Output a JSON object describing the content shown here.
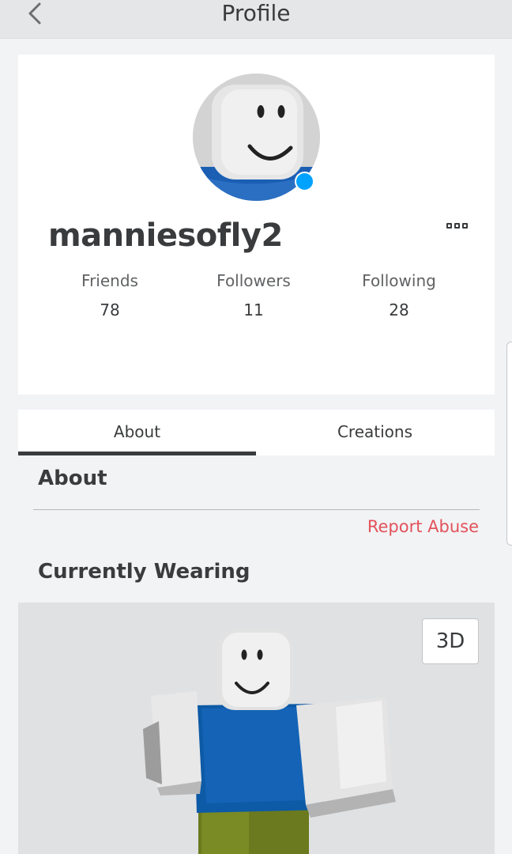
{
  "header": {
    "title": "Profile",
    "back_icon": "chevron-left-icon"
  },
  "profile": {
    "username": "manniesofly2",
    "presence_color": "#00a2ff",
    "more_icon": "more-options-icon",
    "stats": [
      {
        "label": "Friends",
        "count": "78"
      },
      {
        "label": "Followers",
        "count": "11"
      },
      {
        "label": "Following",
        "count": "28"
      }
    ]
  },
  "tabs": [
    {
      "label": "About",
      "active": true
    },
    {
      "label": "Creations",
      "active": false
    }
  ],
  "about": {
    "title": "About",
    "report_label": "Report Abuse",
    "report_color": "#e2525a"
  },
  "wearing": {
    "title": "Currently Wearing",
    "view_button": "3D"
  }
}
